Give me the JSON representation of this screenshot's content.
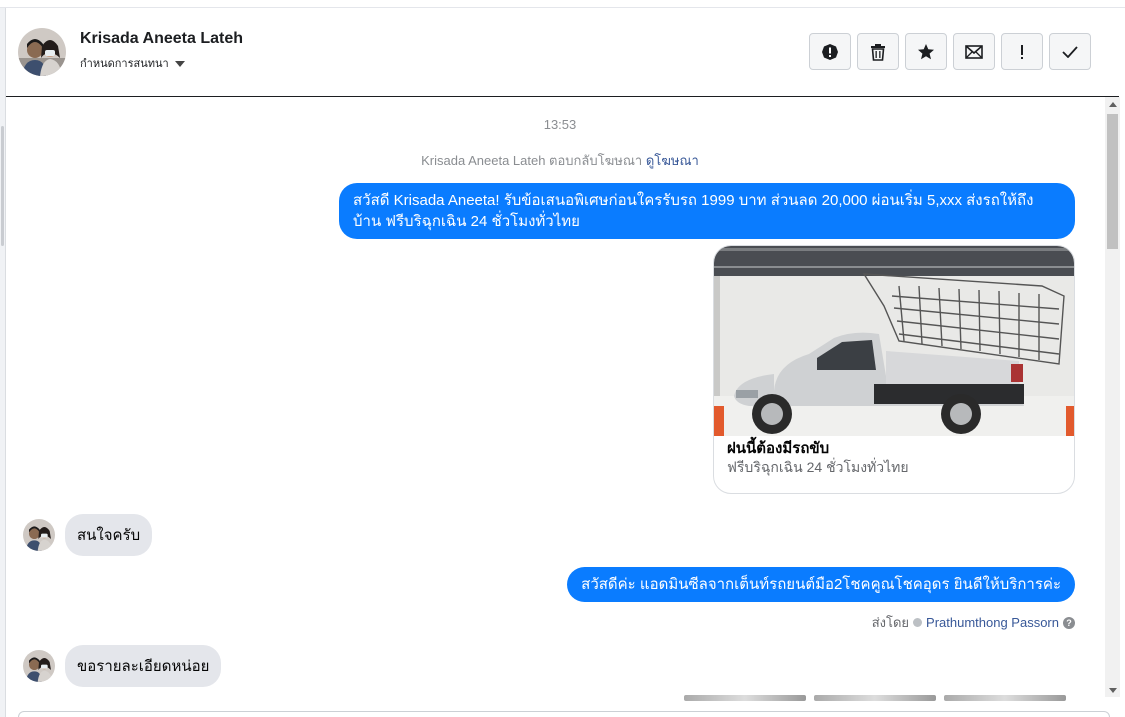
{
  "header": {
    "name": "Krisada Aneeta Lateh",
    "subtitle": "กำหนดการสนทนา",
    "actions": [
      {
        "name": "report-icon",
        "label": ""
      },
      {
        "name": "trash-icon",
        "label": ""
      },
      {
        "name": "star-icon",
        "label": ""
      },
      {
        "name": "mail-icon",
        "label": ""
      },
      {
        "name": "important-icon",
        "label": ""
      },
      {
        "name": "check-icon",
        "label": ""
      }
    ]
  },
  "chat": {
    "timestamp": "13:53",
    "ad_reply_text": "Krisada Aneeta Lateh ตอบกลับโฆษณา",
    "ad_reply_link": "ดูโฆษณา",
    "messages": {
      "m1": "สวัสดี Krisada Aneeta! รับข้อเสนอพิเศษก่อนใครรับรถ 1999 บาท ส่วนลด 20,000  ผ่อนเริ่ม 5,xxx ส่งรถให้ถึงบ้าน ฟรีบริฉุกเฉิน 24 ชั่วโมงทั่วไทย",
      "card_title": "ฝนนี้ต้องมีรถขับ",
      "card_desc": "ฟรีบริฉุกเฉิน 24 ชั่วโมงทั่วไทย",
      "m2": "สนใจครับ",
      "m3": "สวัสดีค่ะ แอดมินซีลจากเต็นท์รถยนต์มือ2โชคคูณโชคอุดร ยินดีให้บริการค่ะ",
      "sent_by_label": "ส่งโดย",
      "sent_by_name": "Prathumthong Passorn",
      "m4": "ขอรายละเอียดหน่อย"
    }
  },
  "colors": {
    "outgoing_bubble": "#0a7cff",
    "incoming_bubble": "#e4e6eb",
    "link": "#385898"
  }
}
